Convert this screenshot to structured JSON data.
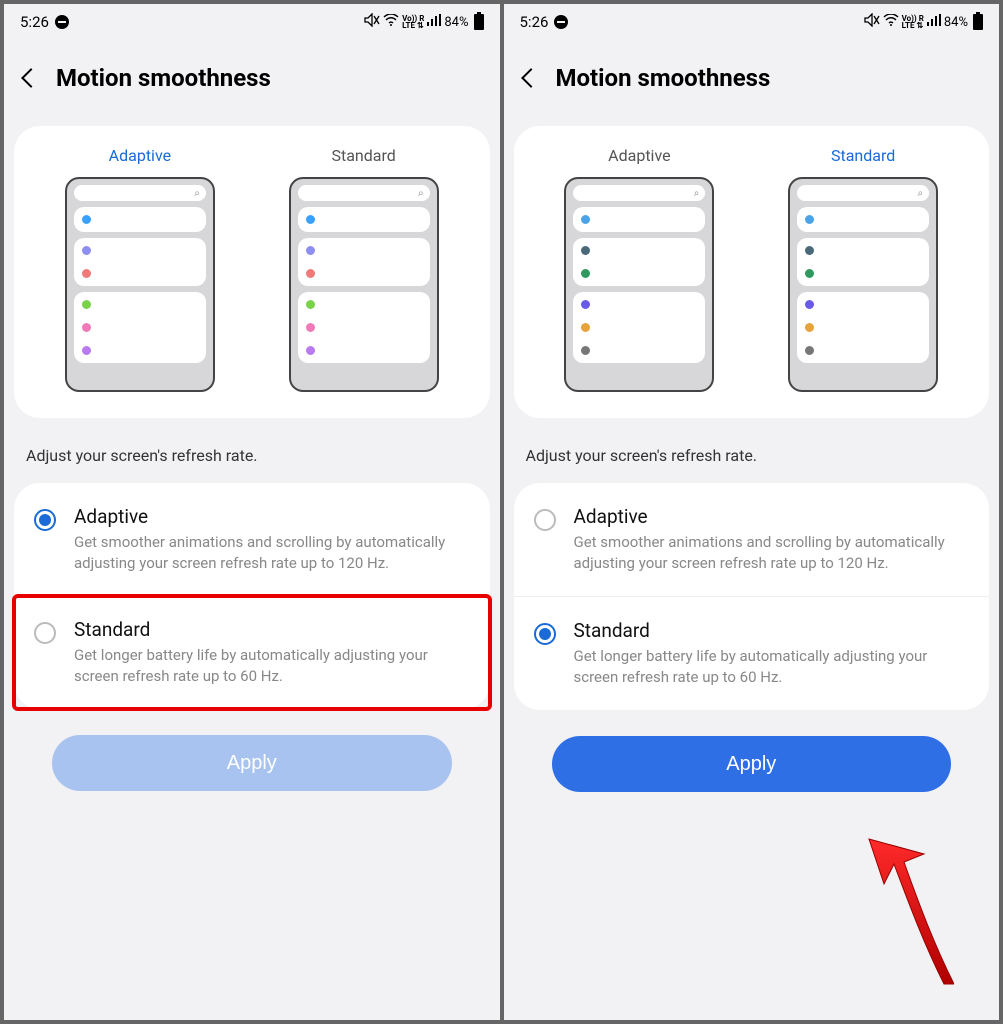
{
  "statusbar": {
    "time": "5:26",
    "battery": "84%"
  },
  "header": {
    "title": "Motion smoothness"
  },
  "previews": {
    "adaptive_label": "Adaptive",
    "standard_label": "Standard"
  },
  "description": "Adjust your screen's refresh rate.",
  "options": {
    "adaptive": {
      "title": "Adaptive",
      "desc": "Get smoother animations and scrolling by automatically adjusting your screen refresh rate up to 120 Hz."
    },
    "standard": {
      "title": "Standard",
      "desc": "Get longer battery life by automatically adjusting your screen refresh rate up to 60 Hz."
    }
  },
  "apply_label": "Apply",
  "left_screen": {
    "selected": "adaptive",
    "apply_enabled": false,
    "highlight_standard": true
  },
  "right_screen": {
    "selected": "standard",
    "apply_enabled": true,
    "arrow": true
  },
  "dot_colors": {
    "adaptive": [
      "#3aa0ff",
      "#8e8ef0",
      "#f07a7a",
      "#79d24a",
      "#f07ab8",
      "#b97af0"
    ],
    "standard": [
      "#4aa3e8",
      "#4a6a7a",
      "#2f9a5f",
      "#6a5ae8",
      "#e8a23a",
      "#777"
    ]
  }
}
